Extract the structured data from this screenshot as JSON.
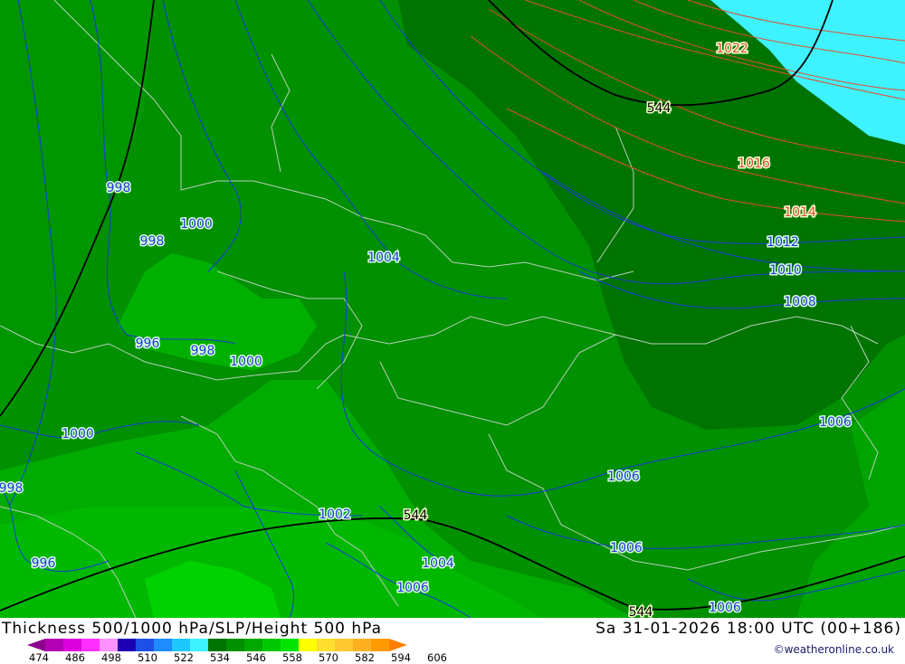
{
  "map": {
    "colors": {
      "band_dark": "#007400",
      "band_mid": "#009000",
      "band_light": "#00a800",
      "band_lighter": "#00b400",
      "band_lightest": "#00d000",
      "cold_sea": "#3ff2ff",
      "isobar_blue": "#1a3ad8",
      "isobar_red": "#e05030",
      "height_line": "#000000",
      "borders": "#b0c8b0"
    },
    "isobar_labels": [
      "998",
      "1000",
      "998",
      "1004",
      "996",
      "998",
      "1000",
      "1000",
      "998",
      "996",
      "1002",
      "1004",
      "1006",
      "1022",
      "1016",
      "1014",
      "1012",
      "1010",
      "1008",
      "1006",
      "1006",
      "1006",
      "1006"
    ],
    "height_labels": [
      "544",
      "544",
      "544"
    ]
  },
  "footer": {
    "title_left": "Thickness 500/1000 hPa/SLP/Height 500 hPa",
    "title_right": "Sa 31-01-2026 18:00 UTC (00+186)",
    "credit": "©weatheronline.co.uk",
    "legend": {
      "colors": [
        "#8c008c",
        "#b400b4",
        "#dc00dc",
        "#ff30ff",
        "#ff90ff",
        "#1e00b4",
        "#1e50e6",
        "#1e8cff",
        "#1ec8ff",
        "#3ff2ff",
        "#007400",
        "#009000",
        "#00a800",
        "#00c800",
        "#00e400",
        "#ffff00",
        "#ffe030",
        "#ffc830",
        "#ffb020",
        "#ff9a00",
        "#ff8000"
      ],
      "ticks": [
        "474",
        "486",
        "498",
        "510",
        "522",
        "534",
        "546",
        "558",
        "570",
        "582",
        "594",
        "606"
      ]
    }
  }
}
